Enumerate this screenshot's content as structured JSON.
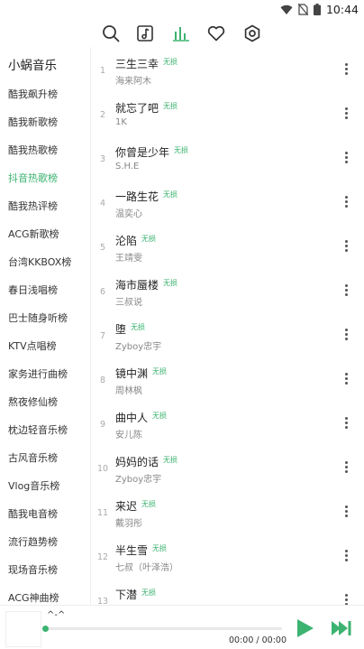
{
  "status_bar": {
    "time": "10:44"
  },
  "toolbar": {
    "icons": [
      "search-icon",
      "music-note-icon",
      "chart-bars-icon",
      "heart-icon",
      "settings-icon"
    ],
    "active_index": 2
  },
  "sidebar": {
    "brand": "小蜗音乐",
    "active_index": 3,
    "items": [
      "酷我飙升榜",
      "酷我新歌榜",
      "酷我热歌榜",
      "抖音热歌榜",
      "酷我热评榜",
      "ACG新歌榜",
      "台湾KKBOX榜",
      "春日浅唱榜",
      "巴士随身听榜",
      "KTV点唱榜",
      "家务进行曲榜",
      "熬夜修仙榜",
      "枕边轻音乐榜",
      "古风音乐榜",
      "Vlog音乐榜",
      "酷我电音榜",
      "流行趋势榜",
      "现场音乐榜",
      "ACG神曲榜"
    ]
  },
  "songs": [
    {
      "index": "1",
      "title": "三生三幸",
      "badge": "无损",
      "artist": "海来阿木"
    },
    {
      "index": "2",
      "title": "就忘了吧",
      "badge": "无损",
      "artist": "1K"
    },
    {
      "index": "3",
      "title": "你曾是少年",
      "badge": "无损",
      "artist": "S.H.E"
    },
    {
      "index": "4",
      "title": "一路生花",
      "badge": "无损",
      "artist": "温奕心"
    },
    {
      "index": "5",
      "title": "沦陷",
      "badge": "无损",
      "artist": "王靖雯"
    },
    {
      "index": "6",
      "title": "海市蜃楼",
      "badge": "无损",
      "artist": "三叔说"
    },
    {
      "index": "7",
      "title": "堕",
      "badge": "无损",
      "artist": "Zyboy忠宇"
    },
    {
      "index": "8",
      "title": "镜中渊",
      "badge": "无损",
      "artist": "周林枫"
    },
    {
      "index": "9",
      "title": "曲中人",
      "badge": "无损",
      "artist": "安儿陈"
    },
    {
      "index": "10",
      "title": "妈妈的话",
      "badge": "无损",
      "artist": "Zyboy忠宇"
    },
    {
      "index": "11",
      "title": "来迟",
      "badge": "无损",
      "artist": "戴羽彤"
    },
    {
      "index": "12",
      "title": "半生雪",
      "badge": "无损",
      "artist": "七叔（叶泽浩）"
    },
    {
      "index": "13",
      "title": "下潜",
      "badge": "无损",
      "artist": ""
    }
  ],
  "player": {
    "title": "^-^",
    "time": "00:00 / 00:00",
    "progress": 0,
    "accent_color": "#3cb371"
  }
}
